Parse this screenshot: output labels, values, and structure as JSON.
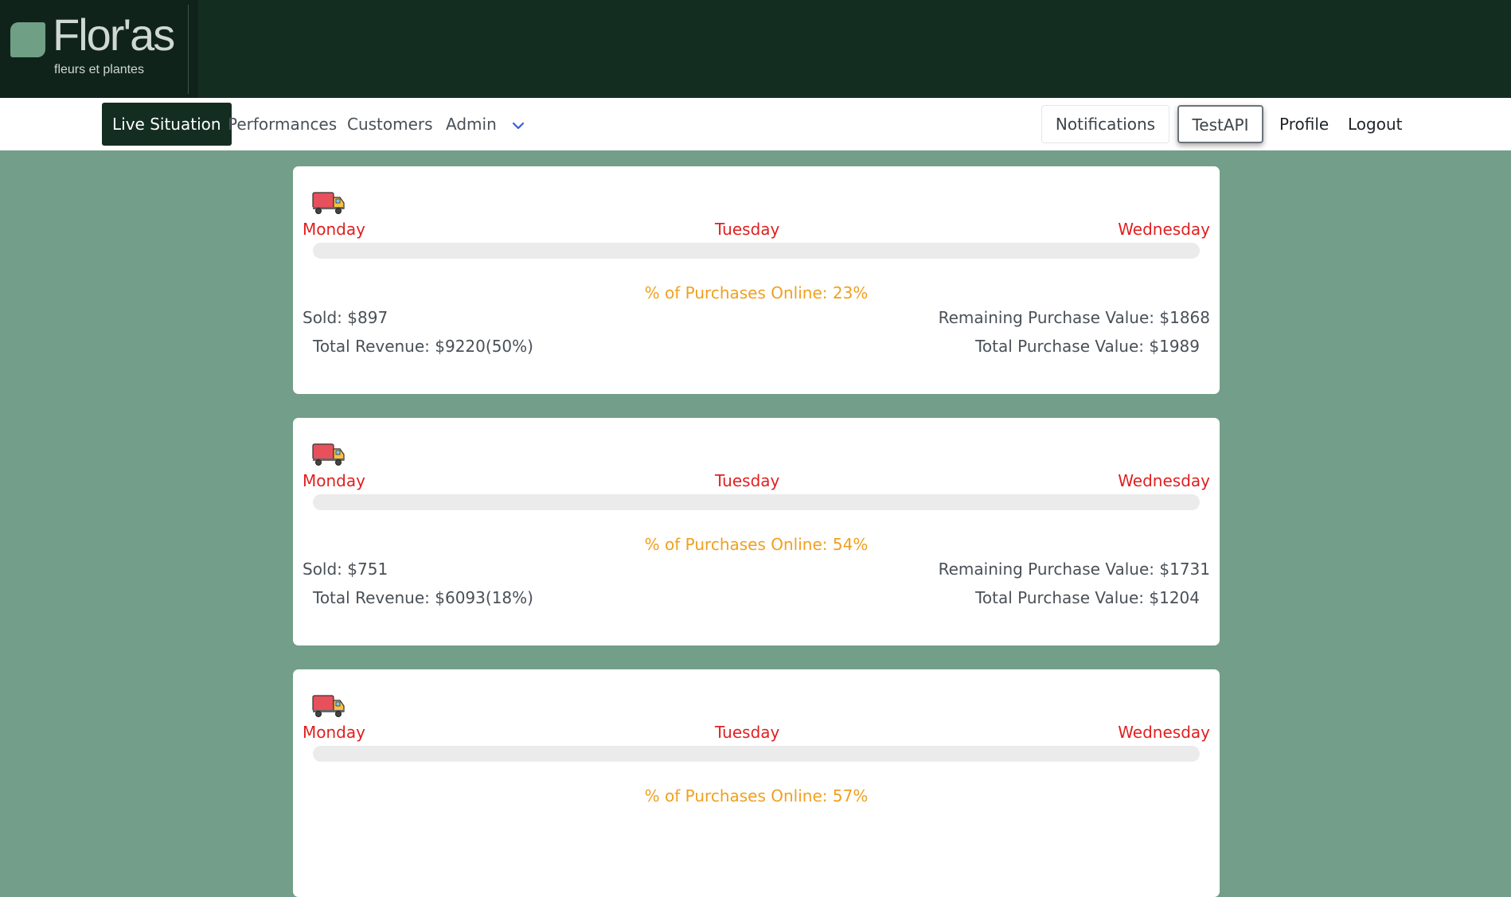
{
  "brand": {
    "name": "Flor'as",
    "tagline": "fleurs et plantes",
    "accent": "#6f9f85",
    "dark": "#142d21"
  },
  "nav": {
    "items": [
      {
        "label": "Live Situation",
        "active": true
      },
      {
        "label": "Performances"
      },
      {
        "label": "Customers"
      },
      {
        "label": "Admin",
        "icon": "chevron-down-icon"
      }
    ],
    "right": {
      "notifications": "Notifications",
      "testapi": "TestAPI",
      "profile": "Profile",
      "logout": "Logout"
    }
  },
  "cards": [
    {
      "icon": "truck-icon",
      "days": [
        "Monday",
        "Tuesday",
        "Wednesday"
      ],
      "progress": 0,
      "online": "% of Purchases Online: 23%",
      "sold": "Sold: $897",
      "revenue": "Total Revenue: $9220(50%)",
      "remaining": "Remaining Purchase Value: $1868",
      "total_purchase": "Total Purchase Value: $1989"
    },
    {
      "icon": "truck-icon",
      "days": [
        "Monday",
        "Tuesday",
        "Wednesday"
      ],
      "progress": 0,
      "online": "% of Purchases Online: 54%",
      "sold": "Sold: $751",
      "revenue": "Total Revenue: $6093(18%)",
      "remaining": "Remaining Purchase Value: $1731",
      "total_purchase": "Total Purchase Value: $1204"
    },
    {
      "icon": "truck-icon",
      "days": [
        "Monday",
        "Tuesday",
        "Wednesday"
      ],
      "progress": 0,
      "online": "% of Purchases Online: 57%",
      "sold": "",
      "revenue": "",
      "remaining": "",
      "total_purchase": ""
    }
  ],
  "colors": {
    "page_bg": "#739e89",
    "day_text": "#e02020",
    "online_text": "#f0a020",
    "track": "#ebebeb"
  }
}
